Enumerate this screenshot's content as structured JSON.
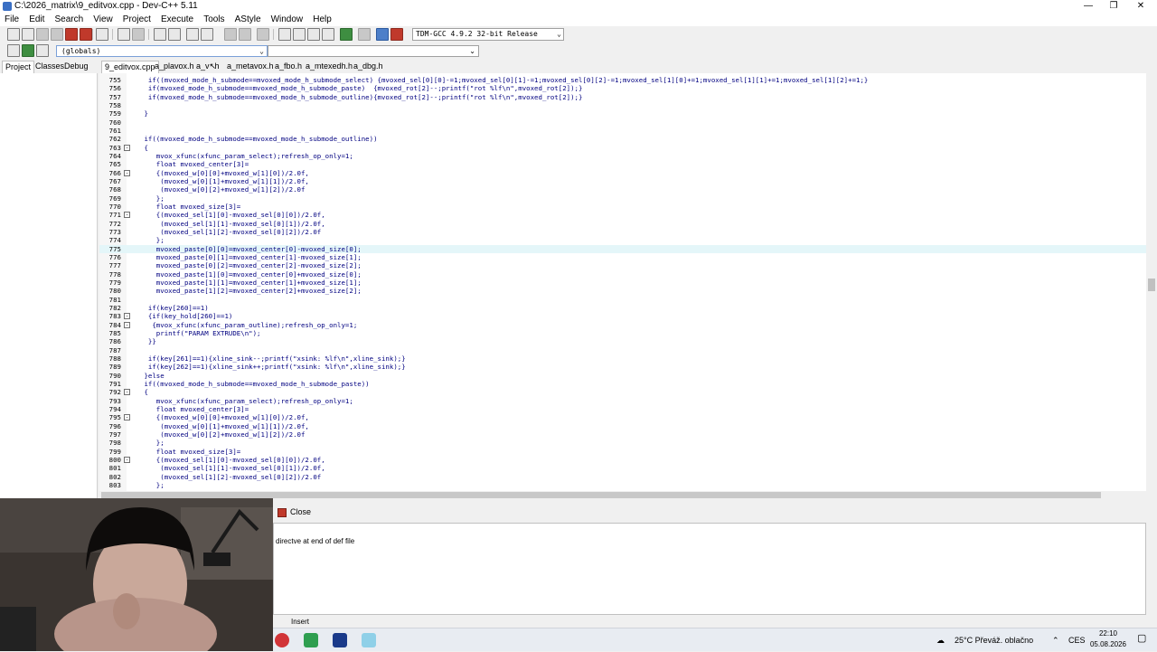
{
  "window": {
    "title": "C:\\2026_matrix\\9_editvox.cpp - Dev-C++ 5.11"
  },
  "menu": [
    "File",
    "Edit",
    "Search",
    "View",
    "Project",
    "Execute",
    "Tools",
    "AStyle",
    "Window",
    "Help"
  ],
  "toolbar": {
    "compiler": "TDM-GCC 4.9.2 32-bit Release"
  },
  "class_bar": {
    "globals": "(globals)"
  },
  "left_tabs": [
    "Project",
    "Classes",
    "Debug"
  ],
  "file_tabs": [
    "9_editvox.cpp",
    "a_plavox.h",
    "a_v",
    "h",
    "a_metavox.h",
    "a_fbo.h",
    "a_mtexedh.h",
    "a_dbg.h"
  ],
  "editor": {
    "lines": [
      {
        "n": "755",
        "t": "  if((mvoxed_mode_h_submode==mvoxed_mode_h_submode_select) {mvoxed_sel[0][0]-=1;mvoxed_sel[0][1]-=1;mvoxed_sel[0][2]-=1;mvoxed_sel[1][0]+=1;mvoxed_sel[1][1]+=1;mvoxed_sel[1][2]+=1;}",
        "fold": ""
      },
      {
        "n": "756",
        "t": "  if(mvoxed_mode_h_submode==mvoxed_mode_h_submode_paste)  {mvoxed_rot[2]--;printf(\"rot %lf\\n\",mvoxed_rot[2]);}",
        "fold": ""
      },
      {
        "n": "757",
        "t": "  if(mvoxed_mode_h_submode==mvoxed_mode_h_submode_outline){mvoxed_rot[2]--;printf(\"rot %lf\\n\",mvoxed_rot[2]);}",
        "fold": ""
      },
      {
        "n": "758",
        "t": "",
        "fold": ""
      },
      {
        "n": "759",
        "t": " }",
        "fold": ""
      },
      {
        "n": "760",
        "t": "",
        "fold": ""
      },
      {
        "n": "761",
        "t": "",
        "fold": ""
      },
      {
        "n": "762",
        "t": " if((mvoxed_mode_h_submode==mvoxed_mode_h_submode_outline))",
        "fold": ""
      },
      {
        "n": "763",
        "t": " {",
        "fold": "-"
      },
      {
        "n": "764",
        "t": "    mvox_xfunc(xfunc_param_select);refresh_op_only=1;",
        "fold": ""
      },
      {
        "n": "765",
        "t": "    float mvoxed_center[3]=",
        "fold": ""
      },
      {
        "n": "766",
        "t": "    {(mvoxed_w[0][0]+mvoxed_w[1][0])/2.0f,",
        "fold": "-"
      },
      {
        "n": "767",
        "t": "     (mvoxed_w[0][1]+mvoxed_w[1][1])/2.0f,",
        "fold": ""
      },
      {
        "n": "768",
        "t": "     (mvoxed_w[0][2]+mvoxed_w[1][2])/2.0f",
        "fold": ""
      },
      {
        "n": "769",
        "t": "    };",
        "fold": ""
      },
      {
        "n": "770",
        "t": "    float mvoxed_size[3]=",
        "fold": ""
      },
      {
        "n": "771",
        "t": "    {(mvoxed_sel[1][0]-mvoxed_sel[0][0])/2.0f,",
        "fold": "-"
      },
      {
        "n": "772",
        "t": "     (mvoxed_sel[1][1]-mvoxed_sel[0][1])/2.0f,",
        "fold": ""
      },
      {
        "n": "773",
        "t": "     (mvoxed_sel[1][2]-mvoxed_sel[0][2])/2.0f",
        "fold": ""
      },
      {
        "n": "774",
        "t": "    };",
        "fold": ""
      },
      {
        "n": "775",
        "t": "    mvoxed_paste[0][0]=mvoxed_center[0]-mvoxed_size[0];",
        "fold": "",
        "hl": true
      },
      {
        "n": "776",
        "t": "    mvoxed_paste[0][1]=mvoxed_center[1]-mvoxed_size[1];",
        "fold": ""
      },
      {
        "n": "777",
        "t": "    mvoxed_paste[0][2]=mvoxed_center[2]-mvoxed_size[2];",
        "fold": ""
      },
      {
        "n": "778",
        "t": "    mvoxed_paste[1][0]=mvoxed_center[0]+mvoxed_size[0];",
        "fold": ""
      },
      {
        "n": "779",
        "t": "    mvoxed_paste[1][1]=mvoxed_center[1]+mvoxed_size[1];",
        "fold": ""
      },
      {
        "n": "780",
        "t": "    mvoxed_paste[1][2]=mvoxed_center[2]+mvoxed_size[2];",
        "fold": ""
      },
      {
        "n": "781",
        "t": "",
        "fold": ""
      },
      {
        "n": "782",
        "t": "  if(key[260]==1)",
        "fold": ""
      },
      {
        "n": "783",
        "t": "  {if(key_hold[260]==1)",
        "fold": "-"
      },
      {
        "n": "784",
        "t": "   {mvox_xfunc(xfunc_param_outline);refresh_op_only=1;",
        "fold": "-"
      },
      {
        "n": "785",
        "t": "    printf(\"PARAM EXTRUDE\\n\");",
        "fold": ""
      },
      {
        "n": "786",
        "t": "  }}",
        "fold": ""
      },
      {
        "n": "787",
        "t": "",
        "fold": ""
      },
      {
        "n": "788",
        "t": "  if(key[261]==1){xline_sink--;printf(\"xsink: %lf\\n\",xline_sink);}",
        "fold": ""
      },
      {
        "n": "789",
        "t": "  if(key[262]==1){xline_sink++;printf(\"xsink: %lf\\n\",xline_sink);}",
        "fold": ""
      },
      {
        "n": "790",
        "t": " }else",
        "fold": ""
      },
      {
        "n": "791",
        "t": " if((mvoxed_mode_h_submode==mvoxed_mode_h_submode_paste))",
        "fold": ""
      },
      {
        "n": "792",
        "t": " {",
        "fold": "-"
      },
      {
        "n": "793",
        "t": "    mvox_xfunc(xfunc_param_select);refresh_op_only=1;",
        "fold": ""
      },
      {
        "n": "794",
        "t": "    float mvoxed_center[3]=",
        "fold": ""
      },
      {
        "n": "795",
        "t": "    {(mvoxed_w[0][0]+mvoxed_w[1][0])/2.0f,",
        "fold": "-"
      },
      {
        "n": "796",
        "t": "     (mvoxed_w[0][1]+mvoxed_w[1][1])/2.0f,",
        "fold": ""
      },
      {
        "n": "797",
        "t": "     (mvoxed_w[0][2]+mvoxed_w[1][2])/2.0f",
        "fold": ""
      },
      {
        "n": "798",
        "t": "    };",
        "fold": ""
      },
      {
        "n": "799",
        "t": "    float mvoxed_size[3]=",
        "fold": ""
      },
      {
        "n": "800",
        "t": "    {(mvoxed_sel[1][0]-mvoxed_sel[0][0])/2.0f,",
        "fold": "-"
      },
      {
        "n": "801",
        "t": "     (mvoxed_sel[1][1]-mvoxed_sel[0][1])/2.0f,",
        "fold": ""
      },
      {
        "n": "802",
        "t": "     (mvoxed_sel[1][2]-mvoxed_sel[0][2])/2.0f",
        "fold": ""
      },
      {
        "n": "803",
        "t": "    };",
        "fold": ""
      }
    ]
  },
  "bottom_panel": {
    "close_label": "Close",
    "message": "directve at end of def file"
  },
  "statusbar": {
    "mode": "Insert"
  },
  "taskbar": {
    "weather": "25°C  Převáž. oblačno",
    "language": "CES",
    "time": "22:10",
    "date": "05.08.2026"
  }
}
